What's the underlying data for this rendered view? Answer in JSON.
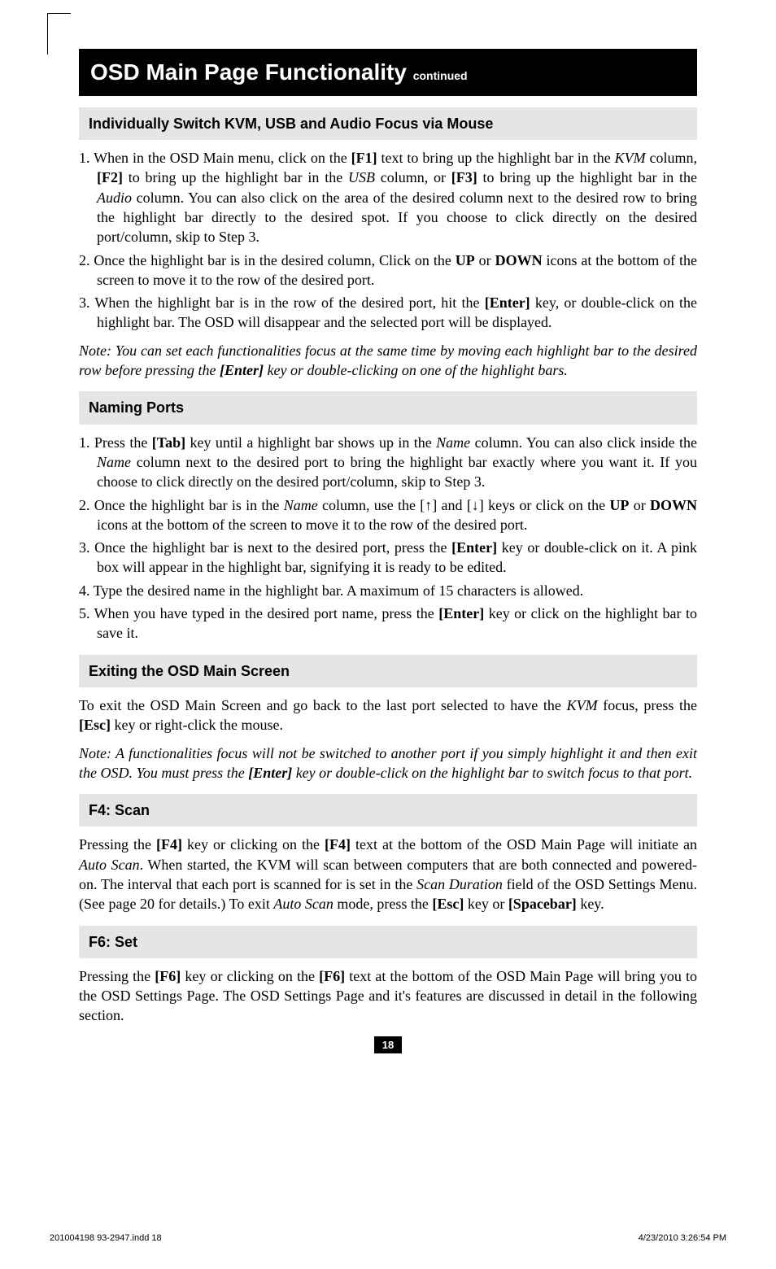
{
  "title_main": "OSD Main Page Functionality",
  "title_cont": "continued",
  "sections": {
    "s1": {
      "head": "Individually Switch KVM, USB and Audio Focus via Mouse",
      "li1a": "1. When in the OSD Main menu, click on the ",
      "li1b": "[F1]",
      "li1c": " text to bring up the highlight bar in the ",
      "li1d": "KVM",
      "li1e": " column, ",
      "li1f": "[F2]",
      "li1g": " to bring up the highlight bar in the ",
      "li1h": "USB",
      "li1i": " column, or ",
      "li1j": "[F3]",
      "li1k": " to bring up the highlight bar in the ",
      "li1l": "Audio",
      "li1m": " column. You can also click on the area of the desired column next to the desired row to bring the highlight bar directly to the desired spot. If you choose to click directly on the desired port/column, skip to Step 3.",
      "li2a": "2. Once the highlight bar is in the desired column, Click on the ",
      "li2b": "UP",
      "li2c": " or ",
      "li2d": "DOWN",
      "li2e": " icons at the bottom of the screen to move it to the row of the desired port.",
      "li3a": "3. When the highlight bar is in the row of the desired port, hit the ",
      "li3b": "[Enter]",
      "li3c": " key, or double-click on the highlight bar. The OSD will disappear and the selected port will be displayed.",
      "note_a": "Note: You can set each functionalities focus at the same time by moving each highlight bar to the desired row before pressing the ",
      "note_b": "[Enter]",
      "note_c": " key or double-clicking on one of the highlight bars."
    },
    "s2": {
      "head": "Naming Ports",
      "li1a": "1. Press the ",
      "li1b": "[Tab]",
      "li1c": " key until a highlight bar shows up in the ",
      "li1d": "Name",
      "li1e": " column. You can also click inside the ",
      "li1f": "Name",
      "li1g": " column next to the desired port to bring the highlight bar exactly where you want it. If you choose to click directly on the desired port/column, skip to Step 3.",
      "li2a": "2. Once the highlight bar is in the ",
      "li2b": "Name",
      "li2c": " column, use the [↑] and [↓] keys or click on the ",
      "li2d": "UP",
      "li2e": " or ",
      "li2f": "DOWN",
      "li2g": " icons at the bottom of the screen to move it to the row of the desired port.",
      "li3a": "3. Once the highlight bar is next to the desired port, press the ",
      "li3b": "[Enter]",
      "li3c": " key or double-click on it. A pink box will appear in the highlight bar, signifying it is ready to be edited.",
      "li4": "4. Type the desired name in the highlight bar. A maximum of 15 characters is allowed.",
      "li5a": "5. When you have typed in the desired port name, press the ",
      "li5b": "[Enter]",
      "li5c": " key or click on the highlight bar to save it."
    },
    "s3": {
      "head": "Exiting the OSD Main Screen",
      "p1a": "To exit the OSD Main Screen and go back to the last port selected to have the ",
      "p1b": "KVM",
      "p1c": " focus, press the ",
      "p1d": "[Esc]",
      "p1e": " key or right-click the mouse.",
      "note_a": "Note: A functionalities focus will not be switched to another port if you simply highlight it and then exit the OSD. You must press the ",
      "note_b": "[Enter]",
      "note_c": " key or double-click on the highlight bar to switch focus to that port."
    },
    "s4": {
      "head": "F4: Scan",
      "p1a": "Pressing the ",
      "p1b": "[F4]",
      "p1c": " key or clicking on the ",
      "p1d": "[F4]",
      "p1e": " text at the bottom of the OSD Main Page will initiate an ",
      "p1f": "Auto Scan",
      "p1g": ". When started, the KVM will scan between computers that are both connected and powered-on. The interval that each port is scanned for is set in the ",
      "p1h": "Scan Duration",
      "p1i": " field of the OSD Settings Menu. (See page 20 for details.) To exit ",
      "p1j": "Auto Scan",
      "p1k": " mode, press the ",
      "p1l": "[Esc]",
      "p1m": " key or ",
      "p1n": "[Spacebar]",
      "p1o": " key."
    },
    "s5": {
      "head": "F6: Set",
      "p1a": "Pressing the ",
      "p1b": "[F6]",
      "p1c": " key or clicking on the ",
      "p1d": "[F6]",
      "p1e": " text at the bottom of the OSD Main Page will bring you to the OSD Settings Page. The OSD Settings Page and it's features are discussed in detail in the following section."
    }
  },
  "page_number": "18",
  "footer_left": "201004198  93-2947.indd   18",
  "footer_right": "4/23/2010   3:26:54 PM"
}
